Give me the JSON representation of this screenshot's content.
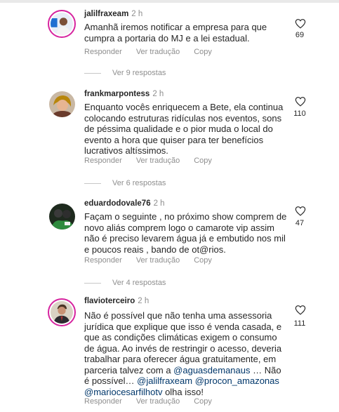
{
  "comments": [
    {
      "username": "jalilfraxeam",
      "time": "2 h",
      "text": "Amanhã iremos notificar a empresa para que cumpra a portaria do MJ e a lei estadual.",
      "likes": "69",
      "actions": [
        "Responder",
        "Ver tradução",
        "Copy"
      ],
      "replies": "Ver 9 respostas"
    },
    {
      "username": "frankmarpontess",
      "time": "2 h",
      "text": "Enquanto vocês enriquecem a Bete, ela continua colocando estruturas ridículas nos eventos, sons de péssima qualidade e o pior muda o local do evento a hora que quiser para ter benefícios lucrativos altíssimos.",
      "likes": "110",
      "actions": [
        "Responder",
        "Ver tradução",
        "Copy"
      ],
      "replies": "Ver 6 respostas"
    },
    {
      "username": "eduardodovale76",
      "time": "2 h",
      "text": "Façam o seguinte , no próximo show comprem de novo aliás comprem logo o camarote vip assim não é preciso levarem água já e embutido nos mil e poucos reais , bando de ot@rios.",
      "likes": "47",
      "actions": [
        "Responder",
        "Ver tradução",
        "Copy"
      ],
      "replies": "Ver 4 respostas"
    },
    {
      "username": "flavioterceiro",
      "time": "2 h",
      "text_parts": [
        "Não é possível que não tenha uma assessoria jurídica que explique que isso é venda casada, e que as condições climáticas exigem o consumo de água. Ao invés de restringir o acesso, deveria trabalhar para oferecer água gratuitamente, em parceria talvez com a ",
        "@aguasdemanaus",
        " … Não é possível… ",
        "@jalilfraxeam",
        " ",
        "@procon_amazonas",
        " ",
        "@mariocesarfilhotv",
        " olha isso!"
      ],
      "likes": "111",
      "actions": [
        "Responder",
        "Ver tradução",
        "Copy"
      ]
    }
  ],
  "colors": {
    "text": "#262626",
    "secondary": "#8e8e8e",
    "mention": "#00376b",
    "story_ring": "#d6249f"
  },
  "icons": {
    "like": "heart-outline-icon"
  }
}
